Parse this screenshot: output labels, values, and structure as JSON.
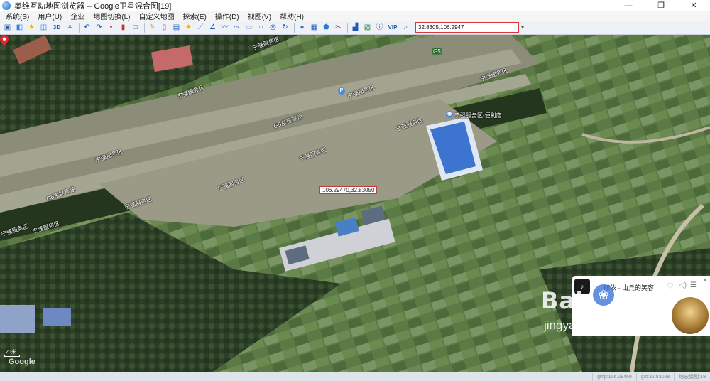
{
  "window": {
    "title": "奥维互动地图浏览器 -- Google卫星混合图[19]",
    "minimize": "—",
    "restore": "❐",
    "close": "✕"
  },
  "menu": [
    {
      "label": "系统(S)"
    },
    {
      "label": "用户(U)"
    },
    {
      "label": "企业"
    },
    {
      "label": "地图切换(L)"
    },
    {
      "label": "自定义地图"
    },
    {
      "label": "探索(E)"
    },
    {
      "label": "操作(D)"
    },
    {
      "label": "视图(V)"
    },
    {
      "label": "帮助(H)"
    }
  ],
  "toolbar": {
    "coordinate_value": "32.8305,106.2947",
    "coordinate_dropdown": "▾",
    "text_buttons": {
      "three_d": "3D",
      "vip": "VIP"
    }
  },
  "map": {
    "labels": {
      "road_g5_a": "G5京昆高速",
      "road_g5_b": "G5京昆高速",
      "road_shield_g5": "G5",
      "service_1": "宁强服务区",
      "service_2": "宁强服务区",
      "service_3": "宁强服务区",
      "service_4": "宁强服务区",
      "service_5": "宁强服务区",
      "service_6": "宁强服务区",
      "service_7": "宁强服务区",
      "service_8": "宁强服务区",
      "service_store": "宁强服务区-便利店",
      "edge_label": "宁强服务区"
    },
    "marker_label": "106.29470,32.83050",
    "poi_parking": "P",
    "poi_store": "◉",
    "scale_text": "20米",
    "brand_text": "Google"
  },
  "music_panel": {
    "song": "耶依 · 山丘的笑容",
    "heart": "♡",
    "volume": "◁)",
    "list": "☰",
    "close": "✕"
  },
  "watermark": {
    "brand": "Bai  经验",
    "paw": "❀",
    "url": "jingyan.baidu.com"
  },
  "status": [
    {
      "label": "gmp:106.29469"
    },
    {
      "label": "gct:32.83028"
    },
    {
      "label": "缩放级别:19"
    }
  ]
}
